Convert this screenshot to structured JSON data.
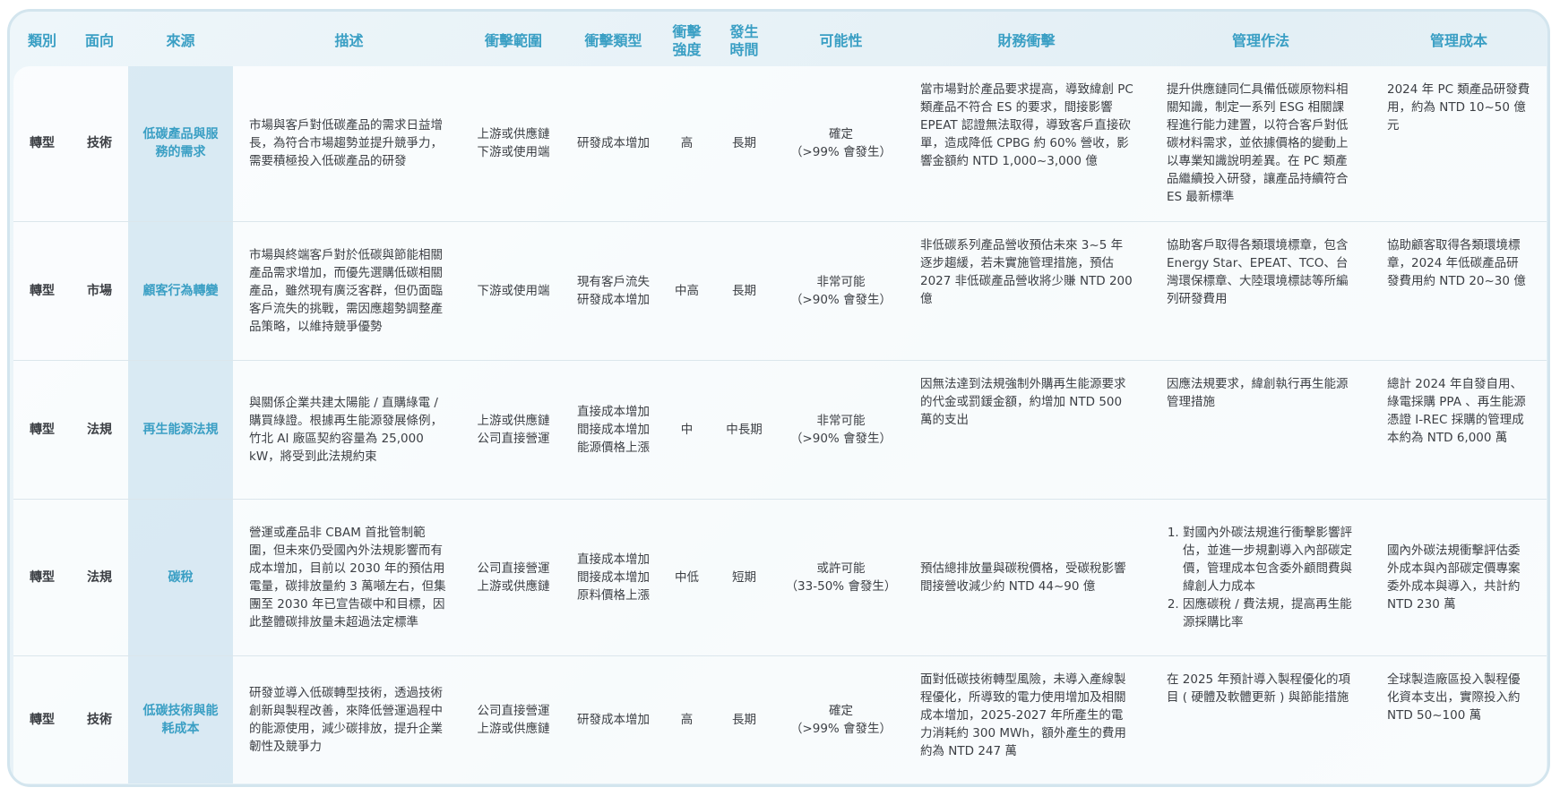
{
  "headers": {
    "category": "類別",
    "aspect": "面向",
    "source": "來源",
    "description": "描述",
    "impact_scope": "衝擊範圍",
    "impact_type": "衝擊類型",
    "impact_intensity_1": "衝擊",
    "impact_intensity_2": "強度",
    "timing_1": "發生",
    "timing_2": "時間",
    "likelihood": "可能性",
    "financial_impact": "財務衝擊",
    "management": "管理作法",
    "management_cost": "管理成本"
  },
  "rows": [
    {
      "category": "轉型",
      "aspect": "技術",
      "source": "低碳產品與服務的需求",
      "description": "市場與客戶對低碳產品的需求日益增長，為符合市場趨勢並提升競爭力，需要積極投入低碳產品的研發",
      "impact_scope": [
        "上游或供應鏈",
        "下游或使用端"
      ],
      "impact_type": [
        "研發成本增加"
      ],
      "intensity": "高",
      "timing": "長期",
      "likelihood": [
        "確定",
        "（>99% 會發生）"
      ],
      "financial_impact": "當市場對於產品要求提高，導致緯創 PC 類產品不符合 ES 的要求，間接影響 EPEAT 認證無法取得，導致客戶直接砍單，造成降低 CPBG 約 60% 營收，影響金額約 NTD 1,000~3,000 億",
      "management": "提升供應鏈同仁具備低碳原物料相關知識，制定一系列 ESG 相關課程進行能力建置，以符合客戶對低碳材料需求，並依據價格的變動上以專業知識說明差異。在 PC 類產品繼續投入研發，讓產品持續符合 ES 最新標準",
      "management_cost": "2024 年 PC 類產品研發費用，約為 NTD 10~50 億元"
    },
    {
      "category": "轉型",
      "aspect": "市場",
      "source": "顧客行為轉變",
      "description": "市場與終端客戶對於低碳與節能相關產品需求增加，而優先選購低碳相關產品，雖然現有廣泛客群，但仍面臨客戶流失的挑戰，需因應趨勢調整產品策略，以維持競爭優勢",
      "impact_scope": [
        "下游或使用端"
      ],
      "impact_type": [
        "現有客戶流失",
        "研發成本增加"
      ],
      "intensity": "中高",
      "timing": "長期",
      "likelihood": [
        "非常可能",
        "（>90% 會發生）"
      ],
      "financial_impact": "非低碳系列產品營收預估未來 3~5 年逐步趨緩，若未實施管理措施，預估 2027 非低碳產品營收將少賺 NTD 200 億",
      "management": "協助客戶取得各類環境標章，包含 Energy Star、EPEAT、TCO、台灣環保標章、大陸環境標誌等所編列研發費用",
      "management_cost": "協助顧客取得各類環境標章，2024 年低碳產品研發費用約 NTD 20~30 億"
    },
    {
      "category": "轉型",
      "aspect": "法規",
      "source": "再生能源法規",
      "description": "與關係企業共建太陽能 / 直購綠電 / 購買綠證。根據再生能源發展條例，竹北 AI 廠區契約容量為 25,000 kW，將受到此法規約束",
      "impact_scope": [
        "上游或供應鏈",
        "公司直接營運"
      ],
      "impact_type": [
        "直接成本增加",
        "間接成本增加",
        "能源價格上漲"
      ],
      "intensity": "中",
      "timing": "中長期",
      "likelihood": [
        "非常可能",
        "（>90% 會發生）"
      ],
      "financial_impact": "因無法達到法規強制外購再生能源要求的代金或罰鍰金額，約增加 NTD 500 萬的支出",
      "management": "因應法規要求，緯創執行再生能源管理措施",
      "management_cost": "總計 2024 年自發自用、綠電採購 PPA 、再生能源憑證 I-REC 採購的管理成本約為 NTD 6,000 萬"
    },
    {
      "category": "轉型",
      "aspect": "法規",
      "source": "碳稅",
      "description": "營運或產品非 CBAM 首批管制範圍，但未來仍受國內外法規影響而有成本增加，目前以 2030 年的預估用電量，碳排放量約 3 萬噸左右，但集團至 2030 年已宣告碳中和目標，因此整體碳排放量未超過法定標準",
      "impact_scope": [
        "公司直接營運",
        "上游或供應鏈"
      ],
      "impact_type": [
        "直接成本增加",
        "間接成本增加",
        "原料價格上漲"
      ],
      "intensity": "中低",
      "timing": "短期",
      "likelihood": [
        "或許可能",
        "（33-50% 會發生）"
      ],
      "financial_impact": "預估總排放量與碳稅價格，受碳稅影響間接營收減少約 NTD 44~90 億",
      "management_list": [
        "對國內外碳法規進行衝擊影響評估，並進一步規劃導入內部碳定價，管理成本包含委外顧問費與緯創人力成本",
        "因應碳稅 / 費法規，提高再生能源採購比率"
      ],
      "management_cost": "國內外碳法規衝擊評估委外成本與內部碳定價專案委外成本與導入，共計約 NTD 230 萬"
    },
    {
      "category": "轉型",
      "aspect": "技術",
      "source": "低碳技術與能耗成本",
      "description": "研發並導入低碳轉型技術，透過技術創新與製程改善，來降低營運過程中的能源使用，減少碳排放，提升企業韌性及競爭力",
      "impact_scope": [
        "公司直接營運",
        "上游或供應鏈"
      ],
      "impact_type": [
        "研發成本增加"
      ],
      "intensity": "高",
      "timing": "長期",
      "likelihood": [
        "確定",
        "（>99% 會發生）"
      ],
      "financial_impact": "面對低碳技術轉型風險，未導入產線製程優化，所導致的電力使用增加及相關成本增加，2025-2027 年所產生的電力消耗約 300 MWh，額外產生的費用約為 NTD 247 萬",
      "management": "在 2025 年預計導入製程優化的項目 ( 硬體及軟體更新 ) 與節能措施",
      "management_cost": "全球製造廠區投入製程優化資本支出，實際投入約 NTD 50~100 萬"
    }
  ]
}
